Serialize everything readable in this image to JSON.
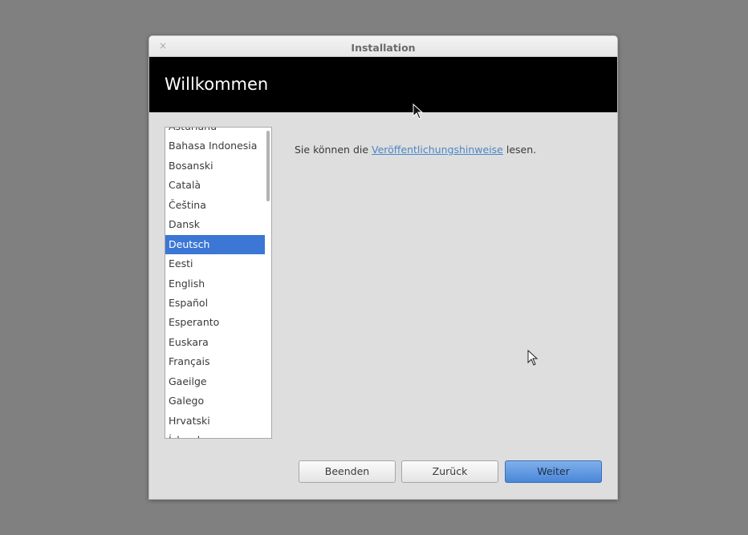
{
  "window": {
    "title": "Installation",
    "close_glyph": "×"
  },
  "header": {
    "title": "Willkommen"
  },
  "languages": {
    "items": [
      "Asturianu",
      "Bahasa Indonesia",
      "Bosanski",
      "Català",
      "Čeština",
      "Dansk",
      "Deutsch",
      "Eesti",
      "English",
      "Español",
      "Esperanto",
      "Euskara",
      "Français",
      "Gaeilge",
      "Galego",
      "Hrvatski",
      "Íslenska"
    ],
    "selected": "Deutsch"
  },
  "notes": {
    "prefix": "Sie können die ",
    "link": "Veröffentlichungshinweise",
    "suffix": " lesen."
  },
  "buttons": {
    "quit": "Beenden",
    "back": "Zurück",
    "next": "Weiter"
  },
  "colors": {
    "selection": "#3c77d6",
    "link": "#4a86c8",
    "header_bg": "#000000",
    "primary_button": "#5b95de"
  }
}
